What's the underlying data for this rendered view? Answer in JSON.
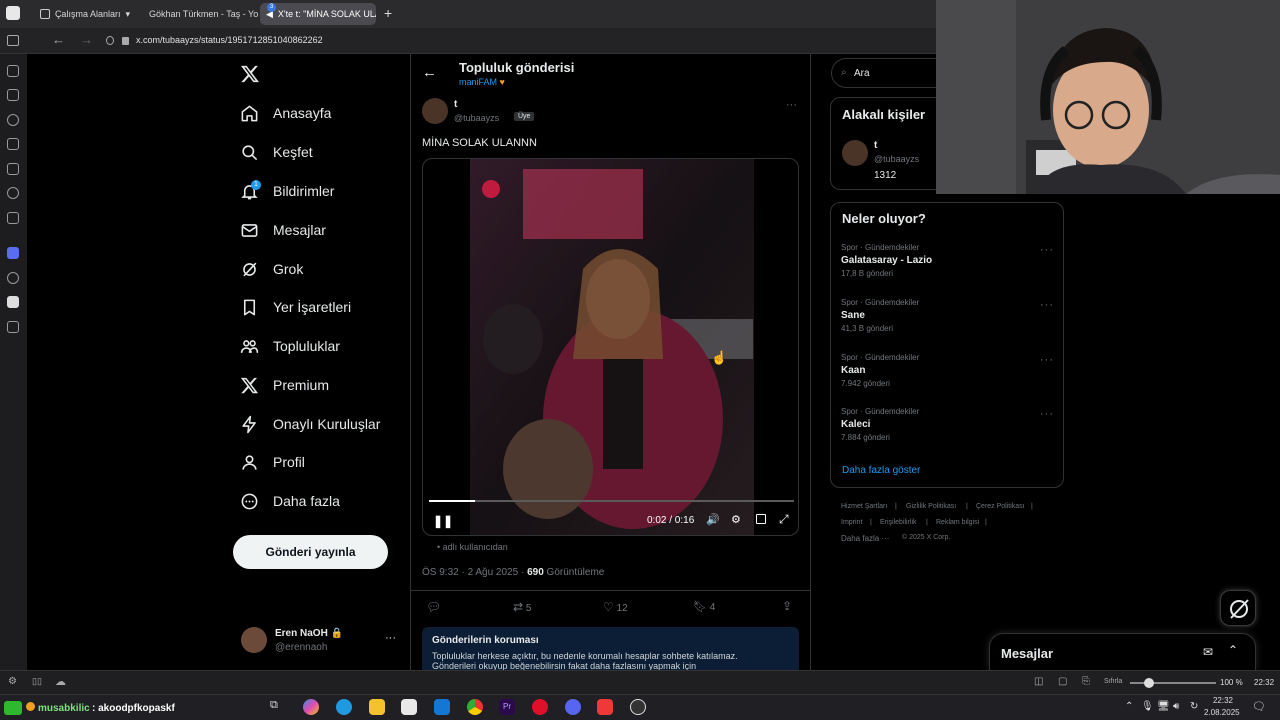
{
  "browser": {
    "tabs": [
      {
        "label": "Çalışma Alanları"
      },
      {
        "label": "Gökhan Türkmen - Taş - Yo"
      },
      {
        "label": "X'te t: \"MİNA SOLAK ULAN"
      }
    ],
    "tab_badge": "3",
    "url": "x.com/tubaayzs/status/1951712851040862262"
  },
  "nav": {
    "items": [
      {
        "label": "Anasayfa",
        "icon": "home-icon"
      },
      {
        "label": "Keşfet",
        "icon": "search-icon"
      },
      {
        "label": "Bildirimler",
        "icon": "bell-icon"
      },
      {
        "label": "Mesajlar",
        "icon": "mail-icon"
      },
      {
        "label": "Grok",
        "icon": "grok-icon"
      },
      {
        "label": "Yer İşaretleri",
        "icon": "bookmark-icon"
      },
      {
        "label": "Topluluklar",
        "icon": "people-icon"
      },
      {
        "label": "Premium",
        "icon": "x-logo-icon"
      },
      {
        "label": "Onaylı Kuruluşlar",
        "icon": "lightning-icon"
      },
      {
        "label": "Profil",
        "icon": "person-icon"
      },
      {
        "label": "Daha fazla",
        "icon": "more-circle-icon"
      }
    ],
    "notification_badge": "1",
    "post_button": "Gönderi yayınla",
    "account": {
      "name": "Eren NaOH",
      "handle": "@erennaoh"
    }
  },
  "post": {
    "header_title": "Topluluk gönderisi",
    "community": "maniFAM",
    "author_name": "t",
    "author_handle": "@tubaayzs",
    "member_badge": "Üye",
    "text": "MİNA SOLAK ULANNN",
    "video_time": "0:02 / 0:16",
    "video_progress": 0.125,
    "video_source": "adlı kullanıcıdan",
    "time": "ÖS 9:32 · 2 Ağu 2025 ·",
    "views": "690",
    "views_label": "Görüntüleme",
    "replies": "",
    "reposts": "5",
    "likes": "12",
    "bookmarks": "4",
    "protection_title": "Gönderilerin koruması",
    "protection_text1": "Topluluklar herkese açıktır, bu nedenle korumalı hesaplar sohbete katılamaz.",
    "protection_text2": "Gönderileri okuyup beğenebilirsin fakat daha fazlasını yapmak için"
  },
  "right": {
    "search_placeholder": "Ara",
    "related_title": "Alakalı kişiler",
    "related_name": "t",
    "related_handle": "@tubaayzs",
    "related_count": "1312",
    "trends_title": "Neler oluyor?",
    "trends": [
      {
        "category": "Spor · Gündemdekiler",
        "name": "Galatasaray - Lazio",
        "count": "17,8 B gönderi"
      },
      {
        "category": "Spor · Gündemdekiler",
        "name": "Sane",
        "count": "41,3 B gönderi"
      },
      {
        "category": "Spor · Gündemdekiler",
        "name": "Kaan",
        "count": "7.942 gönderi"
      },
      {
        "category": "Spor · Gündemdekiler",
        "name": "Kaleci",
        "count": "7.884 gönderi"
      }
    ],
    "show_more": "Daha fazla göster",
    "footer": [
      "Hizmet Şartları",
      "Gizlilik Politikası",
      "Çerez Politikası",
      "Imprint",
      "Erişilebilirlik",
      "Reklam bilgisi",
      "Daha fazla ···",
      "© 2025 X Corp."
    ],
    "messages_title": "Mesajlar"
  },
  "status": {
    "zoom_label": "Sıfırla",
    "zoom": "100 %",
    "clock": "22:32"
  },
  "taskbar": {
    "overlay_text1": "musabkilic",
    "overlay_text2": ": akoodpfkopaskf",
    "time": "22:32",
    "date": "2.08.2025"
  },
  "colors": {
    "accent": "#1d9bf0",
    "community_color": "#1d9bf0",
    "protection_bg": "#0b1e35"
  }
}
